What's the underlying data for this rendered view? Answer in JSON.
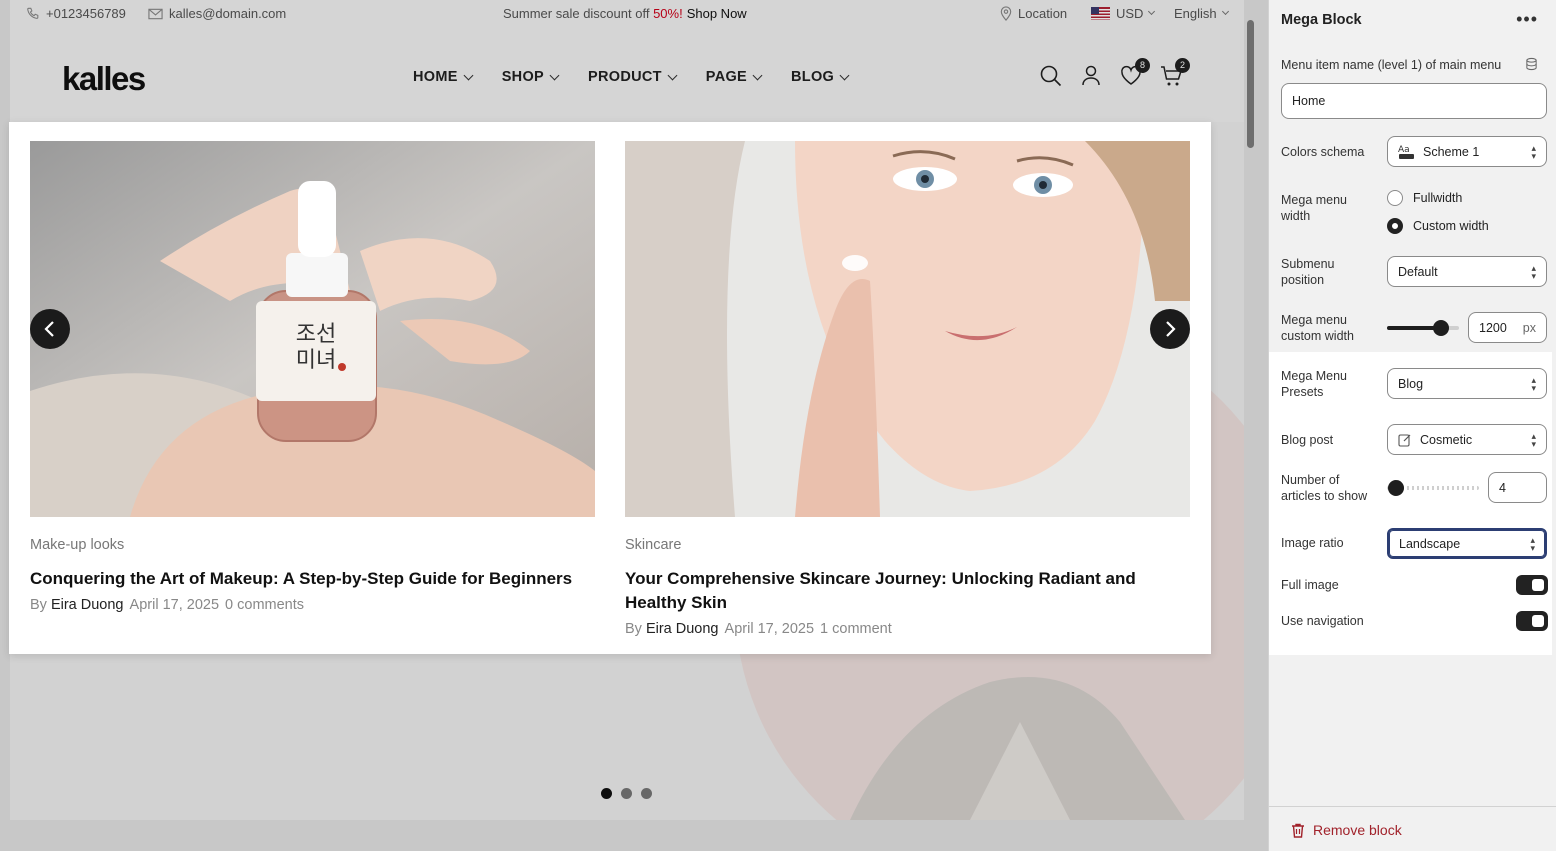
{
  "topbar": {
    "phone": "+0123456789",
    "email": "kalles@domain.com",
    "promo_prefix": "Summer sale discount off ",
    "promo_highlight": "50%!",
    "promo_link": "Shop Now",
    "location": "Location",
    "currency": "USD",
    "language": "English"
  },
  "header": {
    "logo": "kalles",
    "nav": [
      "HOME",
      "SHOP",
      "PRODUCT",
      "PAGE",
      "BLOG"
    ],
    "wishlist_count": "8",
    "cart_count": "2"
  },
  "mega_menu": {
    "articles": [
      {
        "category": "Make-up looks",
        "title": "Conquering the Art of Makeup: A Step-by-Step Guide for Beginners",
        "by": "By",
        "author": "Eira Duong",
        "date": "April 17, 2025",
        "comments": "0 comments",
        "image": "serum-bottle-in-hand"
      },
      {
        "category": "Skincare",
        "title": "Your Comprehensive Skincare Journey: Unlocking Radiant and Healthy Skin",
        "by": "By",
        "author": "Eira Duong",
        "date": "April 17, 2025",
        "comments": "1 comment",
        "image": "woman-applying-cream"
      }
    ]
  },
  "slider": {
    "dot_count": 3,
    "active_index": 0
  },
  "editor": {
    "title": "Mega Block",
    "more_icon": "ellipsis-icon",
    "menu_item_label": "Menu item name (level 1) of main menu",
    "menu_item_value": "Home",
    "colors_schema_label": "Colors schema",
    "colors_schema_value": "Scheme 1",
    "mega_width_label": "Mega menu width",
    "width_options": [
      "Fullwidth",
      "Custom width"
    ],
    "width_selected": "Custom width",
    "submenu_position_label": "Submenu position",
    "submenu_position_value": "Default",
    "custom_width_label": "Mega menu custom width",
    "custom_width_value": "1200",
    "custom_width_unit": "px",
    "custom_width_slider_fraction": 0.75,
    "presets_label": "Mega Menu Presets",
    "presets_value": "Blog",
    "blog_post_label": "Blog post",
    "blog_post_value": "Cosmetic",
    "articles_label": "Number of articles to show",
    "articles_value": "4",
    "articles_slider_fraction": 0.1,
    "image_ratio_label": "Image ratio",
    "image_ratio_value": "Landscape",
    "full_image_label": "Full image",
    "full_image_on": true,
    "use_navigation_label": "Use navigation",
    "use_navigation_on": true,
    "remove_label": "Remove block"
  },
  "colors": {
    "accent_dark": "#222222",
    "promo_red": "#d0021b",
    "remove_red": "#a1222b"
  }
}
